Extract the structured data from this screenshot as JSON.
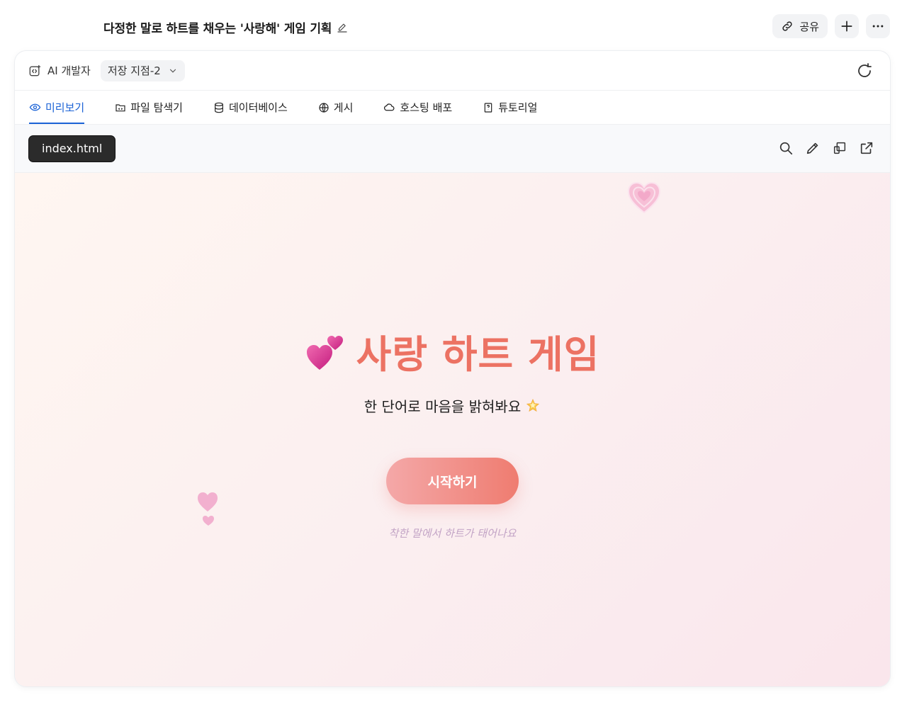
{
  "header": {
    "title": "다정한 말로 하트를 채우는 '사랑해' 게임 기획",
    "share_label": "공유"
  },
  "card": {
    "ai_label": "AI 개발자",
    "save_point": "저장 지점-2"
  },
  "tabs": [
    {
      "label": "미리보기",
      "icon": "eye-icon"
    },
    {
      "label": "파일 탐색기",
      "icon": "folder-icon"
    },
    {
      "label": "데이터베이스",
      "icon": "database-icon"
    },
    {
      "label": "게시",
      "icon": "globe-icon"
    },
    {
      "label": "호스팅 배포",
      "icon": "cloud-icon"
    },
    {
      "label": "튜토리얼",
      "icon": "book-icon"
    }
  ],
  "file_bar": {
    "file_name": "index.html"
  },
  "game": {
    "title": "사랑 하트 게임",
    "subtitle": "한 단어로 마음을 밝혀봐요",
    "start_label": "시작하기",
    "hint": "착한 말에서 하트가 태어나요"
  },
  "colors": {
    "accent": "#1a62d6",
    "title_coral": "#ec7263",
    "button_start": "#f4a8a8",
    "button_end": "#ef7c70",
    "hint": "#c3a4c6"
  }
}
